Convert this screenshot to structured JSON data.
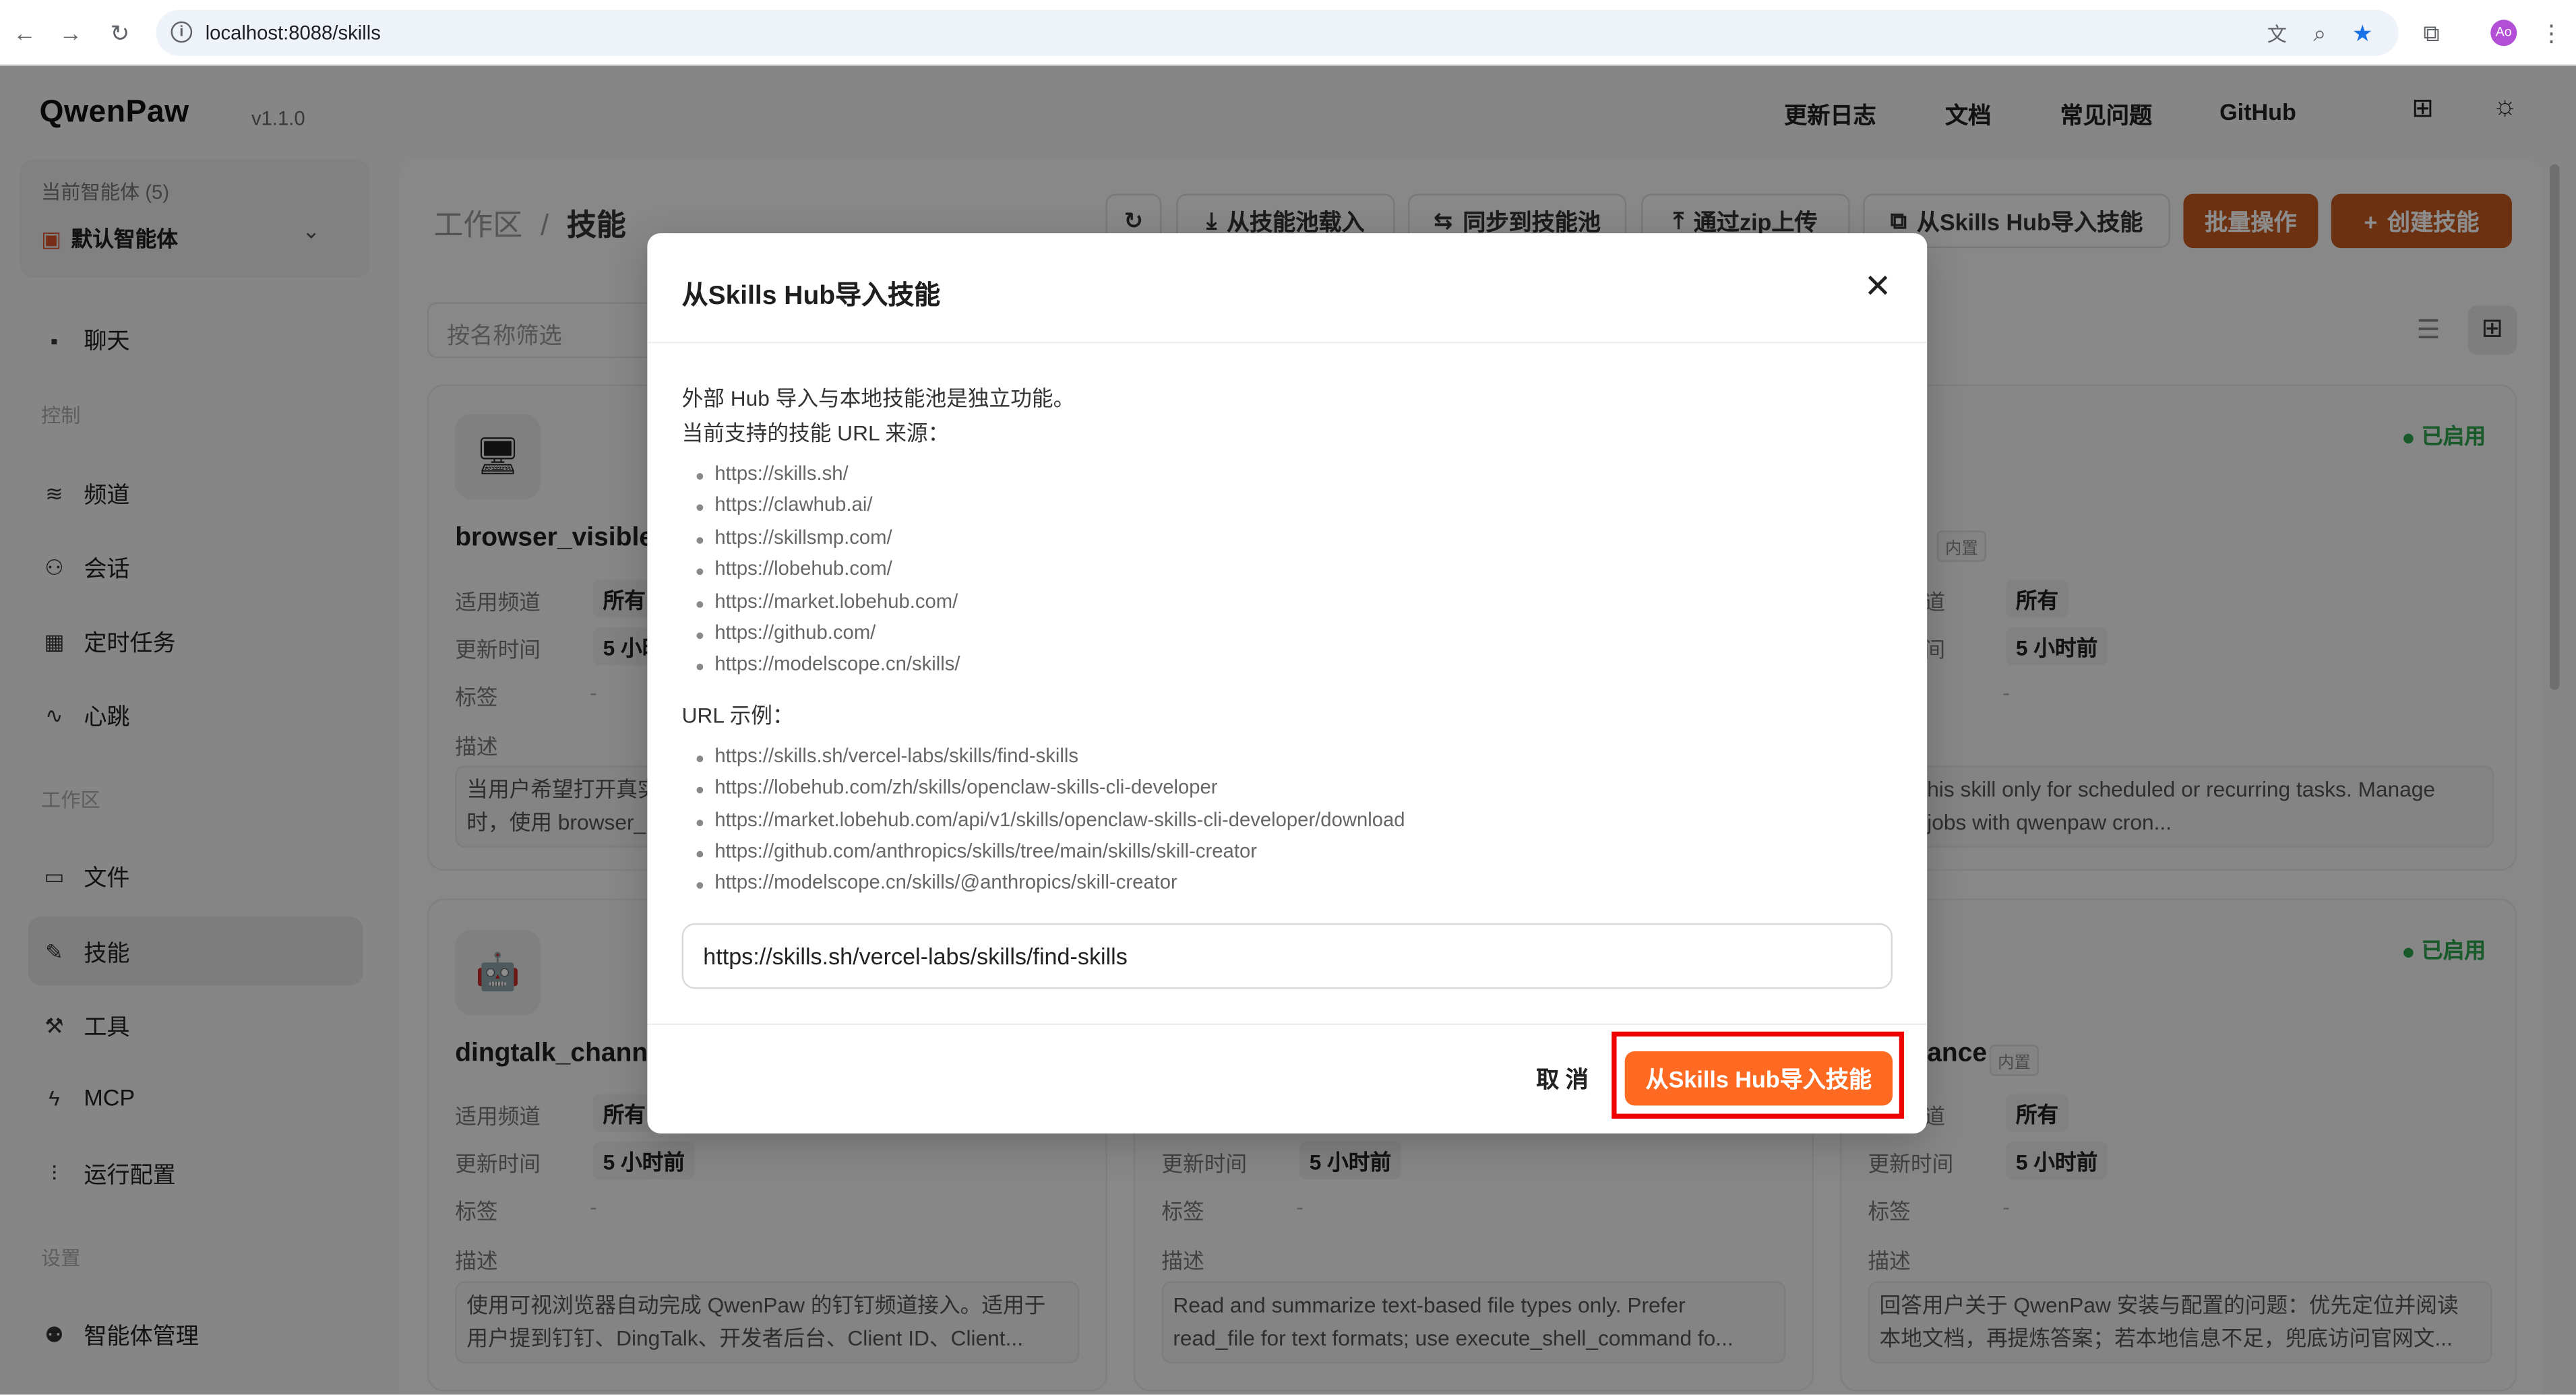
{
  "browser": {
    "url": "localhost:8088/skills",
    "avatar": "Ao"
  },
  "app": {
    "logo": "QwenPaw",
    "version": "v1.1.0"
  },
  "topnav": [
    "更新日志",
    "文档",
    "常见问题",
    "GitHub"
  ],
  "sidebar": {
    "agent_label": "当前智能体 (5)",
    "agent_name": "默认智能体",
    "chat": "聊天",
    "section_control": "控制",
    "control_items": [
      "频道",
      "会话",
      "定时任务",
      "心跳"
    ],
    "section_workspace": "工作区",
    "workspace_items": [
      "文件",
      "技能",
      "工具",
      "MCP",
      "运行配置"
    ],
    "section_settings": "设置",
    "settings_items": [
      "智能体管理"
    ]
  },
  "main": {
    "crumb_root": "工作区",
    "crumb_sep": "/",
    "crumb_page": "技能",
    "toolbar": [
      "从技能池载入",
      "同步到技能池",
      "通过zip上传",
      "从Skills Hub导入技能"
    ],
    "batch": "批量操作",
    "create": "创建技能",
    "filter_placeholder": "按名称筛选"
  },
  "cards": [
    {
      "name": "browser_visible",
      "channel_label": "适用频道",
      "channel": "所有",
      "time_label": "更新时间",
      "time": "5 小时前",
      "tag_label": "标签",
      "tag": "-",
      "desc_label": "描述",
      "desc1": "当用户希望打开真实",
      "desc2": "时，使用 browser_"
    },
    {
      "name": "",
      "builtin": "内置",
      "status": "已启用",
      "channel_label": "道",
      "channel": "所有",
      "time_label": "间",
      "time": "5 小时前",
      "tag": "-",
      "desc1": "his skill only for scheduled or recurring tasks. Manage",
      "desc2": "jobs with qwenpaw cron..."
    },
    {
      "name": "dingtalk_channe",
      "channel_label": "适用频道",
      "channel": "所有",
      "time_label": "更新时间",
      "time": "5 小时前",
      "tag_label": "标签",
      "tag": "-",
      "desc_label": "描述",
      "desc1": "使用可视浏览器自动完成 QwenPaw 的钉钉频道接入。适用于",
      "desc2": "用户提到钉钉、DingTalk、开发者后台、Client ID、Client..."
    },
    {
      "name": "",
      "time_label": "更新时间",
      "time": "5 小时前",
      "tag_label": "标签",
      "tag": "-",
      "desc_label": "描述",
      "desc1": "Read and summarize text-based file types only. Prefer",
      "desc2": "read_file for text formats; use execute_shell_command fo..."
    },
    {
      "name": "ance",
      "builtin": "内置",
      "status": "已启用",
      "channel_label": "道",
      "channel": "所有",
      "time_label": "更新时间",
      "time": "5 小时前",
      "tag_label": "标签",
      "tag": "-",
      "desc_label": "描述",
      "desc1": "回答用户关于 QwenPaw 安装与配置的问题：优先定位并阅读",
      "desc2": "本地文档，再提炼答案；若本地信息不足，兜底访问官网文..."
    }
  ],
  "modal": {
    "title": "从Skills Hub导入技能",
    "intro1": "外部 Hub 导入与本地技能池是独立功能。",
    "intro2": "当前支持的技能 URL 来源：",
    "sources": [
      "https://skills.sh/",
      "https://clawhub.ai/",
      "https://skillsmp.com/",
      "https://lobehub.com/",
      "https://market.lobehub.com/",
      "https://github.com/",
      "https://modelscope.cn/skills/"
    ],
    "examples_label": "URL 示例：",
    "examples": [
      "https://skills.sh/vercel-labs/skills/find-skills",
      "https://lobehub.com/zh/skills/openclaw-skills-cli-developer",
      "https://market.lobehub.com/api/v1/skills/openclaw-skills-cli-developer/download",
      "https://github.com/anthropics/skills/tree/main/skills/skill-creator",
      "https://modelscope.cn/skills/@anthropics/skill-creator"
    ],
    "input_value": "https://skills.sh/vercel-labs/skills/find-skills",
    "cancel": "取 消",
    "confirm": "从Skills Hub导入技能",
    "close_glyph": "✕"
  },
  "colors": {
    "accent": "#ff6a22",
    "accent_dim": "#c5591f",
    "enabled": "#2da44e",
    "highlight_box": "#ee0000"
  }
}
